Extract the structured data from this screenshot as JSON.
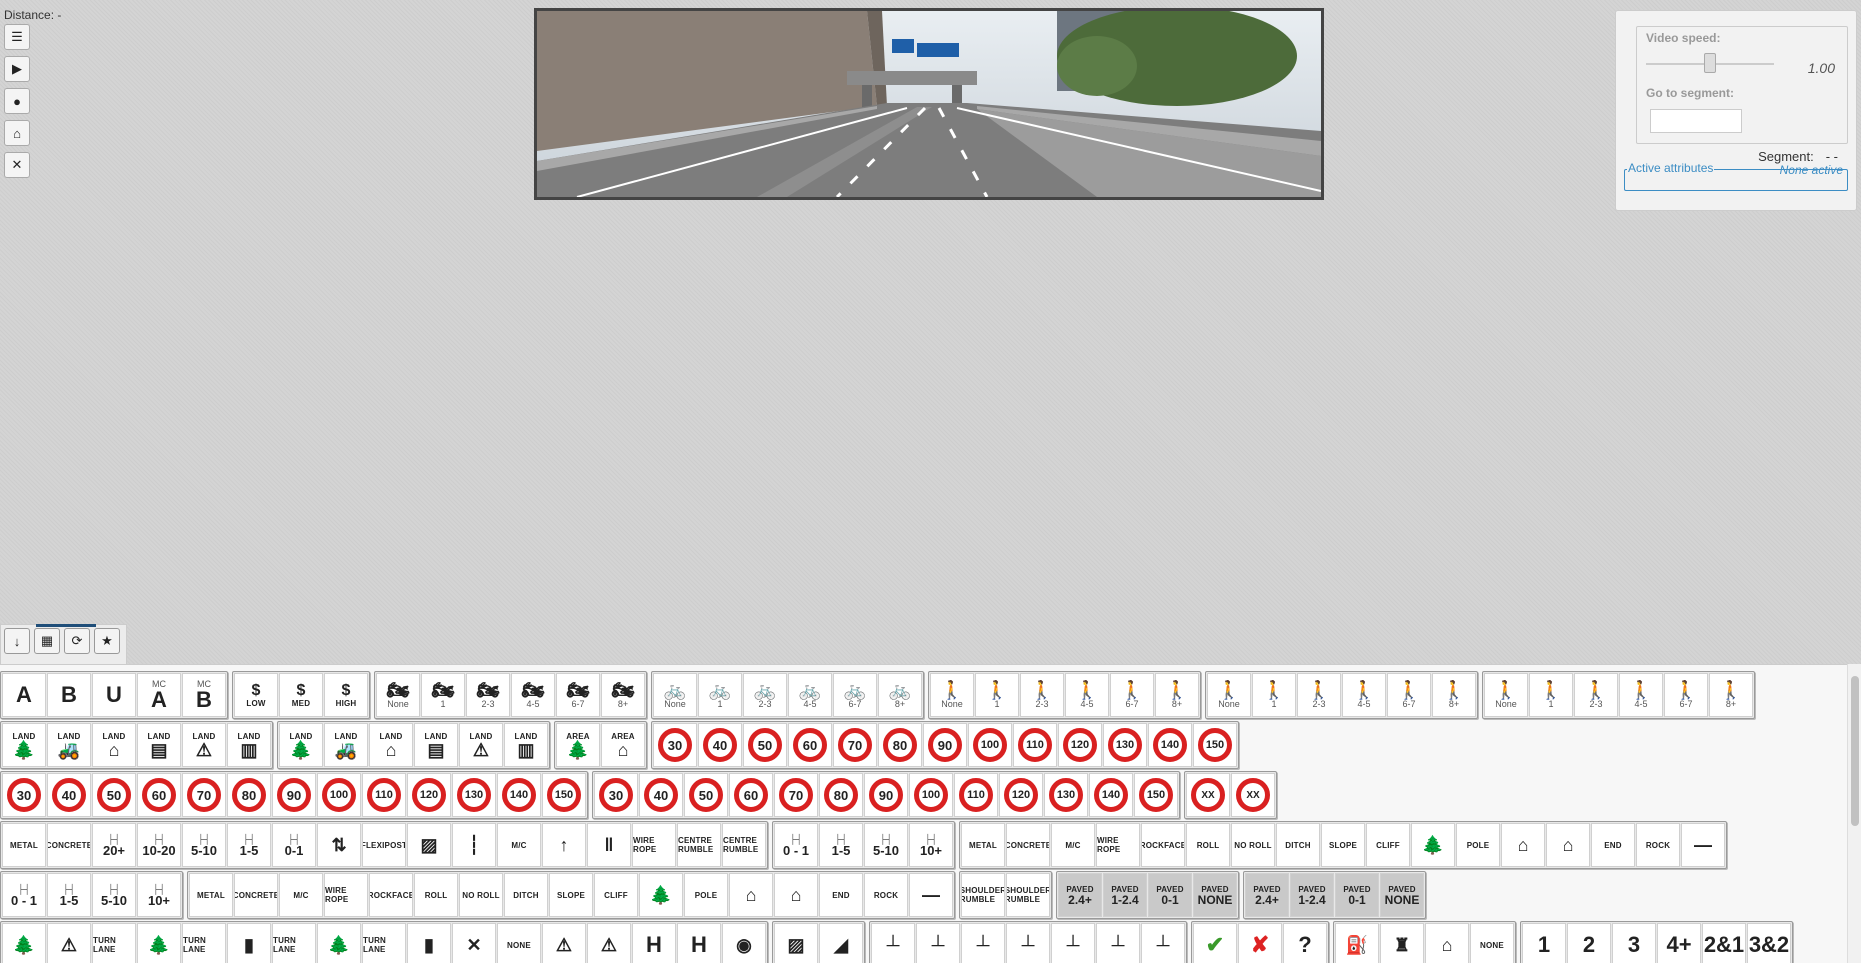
{
  "distance": "Distance: -",
  "panel": {
    "video_speed_label": "Video speed:",
    "video_speed_value": "1.00",
    "video_speed_level": 0.5,
    "goto_label": "Go to segment:",
    "segment_label": "Segment:",
    "segment_value": "- -",
    "active_title": "Active attributes",
    "active_value": "None active"
  },
  "side_tools": [
    "list-icon",
    "video-camera-icon",
    "map-pin-icon",
    "home-icon",
    "shuffle-icon"
  ],
  "tabs": [
    "arrow-down-icon",
    "grid-icon",
    "refresh-icon",
    "star-icon"
  ],
  "rows": [
    [
      [
        {
          "t": "big",
          "v": "A"
        },
        {
          "t": "big",
          "v": "B"
        },
        {
          "t": "big",
          "v": "U"
        },
        {
          "t": "bigsub",
          "v": "A",
          "s": "MC"
        },
        {
          "t": "bigsub",
          "v": "B",
          "s": "MC"
        }
      ],
      [
        {
          "t": "dollar",
          "v": "LOW"
        },
        {
          "t": "dollar",
          "v": "MED"
        },
        {
          "t": "dollar",
          "v": "HIGH"
        }
      ],
      [
        {
          "t": "icon",
          "i": "motorcycle-icon",
          "v": "None"
        },
        {
          "t": "icon",
          "i": "motorcycle-icon",
          "v": "1"
        },
        {
          "t": "icon",
          "i": "motorcycle-icon",
          "v": "2-3"
        },
        {
          "t": "icon",
          "i": "motorcycle-icon",
          "v": "4-5"
        },
        {
          "t": "icon",
          "i": "motorcycle-icon",
          "v": "6-7"
        },
        {
          "t": "icon",
          "i": "motorcycle-icon",
          "v": "8+"
        }
      ],
      [
        {
          "t": "icon",
          "i": "bicycle-icon",
          "v": "None"
        },
        {
          "t": "icon",
          "i": "bicycle-icon",
          "v": "1"
        },
        {
          "t": "icon",
          "i": "bicycle-icon",
          "v": "2-3"
        },
        {
          "t": "icon",
          "i": "bicycle-icon",
          "v": "4-5"
        },
        {
          "t": "icon",
          "i": "bicycle-icon",
          "v": "6-7"
        },
        {
          "t": "icon",
          "i": "bicycle-icon",
          "v": "8+"
        }
      ],
      [
        {
          "t": "icon",
          "i": "pedestrian-crossing-icon",
          "v": "None"
        },
        {
          "t": "icon",
          "i": "pedestrian-crossing-icon",
          "v": "1"
        },
        {
          "t": "icon",
          "i": "pedestrian-crossing-icon",
          "v": "2-3"
        },
        {
          "t": "icon",
          "i": "pedestrian-crossing-icon",
          "v": "4-5"
        },
        {
          "t": "icon",
          "i": "pedestrian-crossing-icon",
          "v": "6-7"
        },
        {
          "t": "icon",
          "i": "pedestrian-crossing-icon",
          "v": "8+"
        }
      ],
      [
        {
          "t": "icon",
          "i": "pedestrian-along-icon",
          "v": "None"
        },
        {
          "t": "icon",
          "i": "pedestrian-along-icon",
          "v": "1"
        },
        {
          "t": "icon",
          "i": "pedestrian-along-icon",
          "v": "2-3"
        },
        {
          "t": "icon",
          "i": "pedestrian-along-icon",
          "v": "4-5"
        },
        {
          "t": "icon",
          "i": "pedestrian-along-icon",
          "v": "6-7"
        },
        {
          "t": "icon",
          "i": "pedestrian-along-icon",
          "v": "8+"
        }
      ],
      [
        {
          "t": "icon",
          "i": "pedestrian-walking-icon",
          "v": "None"
        },
        {
          "t": "icon",
          "i": "pedestrian-walking-icon",
          "v": "1"
        },
        {
          "t": "icon",
          "i": "pedestrian-walking-icon",
          "v": "2-3"
        },
        {
          "t": "icon",
          "i": "pedestrian-walking-icon",
          "v": "4-5"
        },
        {
          "t": "icon",
          "i": "pedestrian-walking-icon",
          "v": "6-7"
        },
        {
          "t": "icon",
          "i": "pedestrian-walking-icon",
          "v": "8+"
        }
      ]
    ],
    [
      [
        {
          "t": "land",
          "i": "tree-icon",
          "s": "LAND"
        },
        {
          "t": "land",
          "i": "tractor-icon",
          "s": "LAND"
        },
        {
          "t": "land",
          "i": "house-icon",
          "s": "LAND"
        },
        {
          "t": "land",
          "i": "building-icon",
          "s": "LAND"
        },
        {
          "t": "land",
          "i": "school-warning-icon",
          "s": "LAND"
        },
        {
          "t": "land",
          "i": "factory-icon",
          "s": "LAND"
        }
      ],
      [
        {
          "t": "land",
          "i": "tree-icon",
          "s": "LAND"
        },
        {
          "t": "land",
          "i": "tractor-icon",
          "s": "LAND"
        },
        {
          "t": "land",
          "i": "house-icon",
          "s": "LAND"
        },
        {
          "t": "land",
          "i": "building-icon",
          "s": "LAND"
        },
        {
          "t": "land",
          "i": "school-warning-icon",
          "s": "LAND"
        },
        {
          "t": "land",
          "i": "factory-icon",
          "s": "LAND"
        }
      ],
      [
        {
          "t": "land",
          "i": "tree-icon",
          "s": "AREA"
        },
        {
          "t": "land",
          "i": "house-icon",
          "s": "AREA"
        }
      ],
      [
        {
          "t": "speed",
          "v": "30"
        },
        {
          "t": "speed",
          "v": "40"
        },
        {
          "t": "speed",
          "v": "50"
        },
        {
          "t": "speed",
          "v": "60"
        },
        {
          "t": "speed",
          "v": "70"
        },
        {
          "t": "speed",
          "v": "80"
        },
        {
          "t": "speed",
          "v": "90"
        },
        {
          "t": "speed",
          "v": "100"
        },
        {
          "t": "speed",
          "v": "110"
        },
        {
          "t": "speed",
          "v": "120"
        },
        {
          "t": "speed",
          "v": "130"
        },
        {
          "t": "speed",
          "v": "140"
        },
        {
          "t": "speed",
          "v": "150"
        }
      ]
    ],
    [
      [
        {
          "t": "speed",
          "v": "30"
        },
        {
          "t": "speed",
          "v": "40"
        },
        {
          "t": "speed",
          "v": "50"
        },
        {
          "t": "speed",
          "v": "60"
        },
        {
          "t": "speed",
          "v": "70"
        },
        {
          "t": "speed",
          "v": "80"
        },
        {
          "t": "speed",
          "v": "90"
        },
        {
          "t": "speed",
          "v": "100"
        },
        {
          "t": "speed",
          "v": "110"
        },
        {
          "t": "speed",
          "v": "120"
        },
        {
          "t": "speed",
          "v": "130"
        },
        {
          "t": "speed",
          "v": "140"
        },
        {
          "t": "speed",
          "v": "150"
        }
      ],
      [
        {
          "t": "speed",
          "v": "30"
        },
        {
          "t": "speed",
          "v": "40"
        },
        {
          "t": "speed",
          "v": "50"
        },
        {
          "t": "speed",
          "v": "60"
        },
        {
          "t": "speed",
          "v": "70"
        },
        {
          "t": "speed",
          "v": "80"
        },
        {
          "t": "speed",
          "v": "90"
        },
        {
          "t": "speed",
          "v": "100"
        },
        {
          "t": "speed",
          "v": "110"
        },
        {
          "t": "speed",
          "v": "120"
        },
        {
          "t": "speed",
          "v": "130"
        },
        {
          "t": "speed",
          "v": "140"
        },
        {
          "t": "speed",
          "v": "150"
        }
      ],
      [
        {
          "t": "speedx",
          "v": "XX"
        },
        {
          "t": "speedx",
          "v": "XX"
        }
      ]
    ],
    [
      [
        {
          "t": "small",
          "v": "METAL"
        },
        {
          "t": "small",
          "v": "CONCRETE"
        },
        {
          "t": "dist",
          "v": "20+"
        },
        {
          "t": "dist",
          "v": "10-20"
        },
        {
          "t": "dist",
          "v": "5-10"
        },
        {
          "t": "dist",
          "v": "1-5"
        },
        {
          "t": "dist",
          "v": "0-1"
        },
        {
          "t": "icon",
          "i": "barrier-icon",
          "v": ""
        },
        {
          "t": "small",
          "v": "FLEXIPOST"
        },
        {
          "t": "icon",
          "i": "hatched-icon",
          "v": ""
        },
        {
          "t": "icon",
          "i": "dashed-line-icon",
          "v": ""
        },
        {
          "t": "small",
          "v": "M/C"
        },
        {
          "t": "icon",
          "i": "arrow-up-icon",
          "v": ""
        },
        {
          "t": "icon",
          "i": "double-line-icon",
          "v": ""
        },
        {
          "t": "small",
          "v": "WIRE ROPE"
        },
        {
          "t": "small",
          "v": "CENTRE RUMBLE"
        },
        {
          "t": "small",
          "v": "CENTRE RUMBLE"
        }
      ],
      [
        {
          "t": "dist",
          "v": "0 - 1"
        },
        {
          "t": "dist",
          "v": "1-5"
        },
        {
          "t": "dist",
          "v": "5-10"
        },
        {
          "t": "dist",
          "v": "10+"
        }
      ],
      [
        {
          "t": "small",
          "v": "METAL"
        },
        {
          "t": "small",
          "v": "CONCRETE"
        },
        {
          "t": "small",
          "v": "M/C"
        },
        {
          "t": "small",
          "v": "WIRE ROPE"
        },
        {
          "t": "small",
          "v": "ROCKFACE"
        },
        {
          "t": "small",
          "v": "ROLL"
        },
        {
          "t": "small",
          "v": "NO ROLL"
        },
        {
          "t": "small",
          "v": "DITCH"
        },
        {
          "t": "small",
          "v": "SLOPE"
        },
        {
          "t": "small",
          "v": "CLIFF"
        },
        {
          "t": "icon",
          "i": "tree-icon",
          "v": ""
        },
        {
          "t": "small",
          "v": "POLE"
        },
        {
          "t": "icon",
          "i": "house-icon",
          "v": ""
        },
        {
          "t": "icon",
          "i": "house-outline-icon",
          "v": ""
        },
        {
          "t": "small",
          "v": "END"
        },
        {
          "t": "small",
          "v": "ROCK"
        },
        {
          "t": "icon",
          "i": "line-icon",
          "v": ""
        }
      ]
    ],
    [
      [
        {
          "t": "dist",
          "v": "0 - 1"
        },
        {
          "t": "dist",
          "v": "1-5"
        },
        {
          "t": "dist",
          "v": "5-10"
        },
        {
          "t": "dist",
          "v": "10+"
        }
      ],
      [
        {
          "t": "small",
          "v": "METAL"
        },
        {
          "t": "small",
          "v": "CONCRETE"
        },
        {
          "t": "small",
          "v": "M/C"
        },
        {
          "t": "small",
          "v": "WIRE ROPE"
        },
        {
          "t": "small",
          "v": "ROCKFACE"
        },
        {
          "t": "small",
          "v": "ROLL"
        },
        {
          "t": "small",
          "v": "NO ROLL"
        },
        {
          "t": "small",
          "v": "DITCH"
        },
        {
          "t": "small",
          "v": "SLOPE"
        },
        {
          "t": "small",
          "v": "CLIFF"
        },
        {
          "t": "icon",
          "i": "tree-icon",
          "v": ""
        },
        {
          "t": "small",
          "v": "POLE"
        },
        {
          "t": "icon",
          "i": "house-icon",
          "v": ""
        },
        {
          "t": "icon",
          "i": "house-outline-icon",
          "v": ""
        },
        {
          "t": "small",
          "v": "END"
        },
        {
          "t": "small",
          "v": "ROCK"
        },
        {
          "t": "icon",
          "i": "line-icon",
          "v": ""
        }
      ],
      [
        {
          "t": "small",
          "v": "SHOULDER RUMBLE"
        },
        {
          "t": "small",
          "v": "SHOULDER RUMBLE"
        }
      ],
      [
        {
          "t": "paved",
          "v": "2.4+"
        },
        {
          "t": "paved",
          "v": "1-2.4"
        },
        {
          "t": "paved",
          "v": "0-1"
        },
        {
          "t": "paved",
          "v": "NONE"
        }
      ],
      [
        {
          "t": "paved",
          "v": "2.4+"
        },
        {
          "t": "paved",
          "v": "1-2.4"
        },
        {
          "t": "paved",
          "v": "0-1"
        },
        {
          "t": "paved",
          "v": "NONE"
        }
      ]
    ],
    [
      [
        {
          "t": "icon",
          "i": "tree-icon",
          "v": ""
        },
        {
          "t": "icon",
          "i": "warning-icon",
          "v": ""
        },
        {
          "t": "small",
          "v": "TURN LANE"
        },
        {
          "t": "icon",
          "i": "tree-icon",
          "v": ""
        },
        {
          "t": "small",
          "v": "TURN LANE"
        },
        {
          "t": "icon",
          "i": "traffic-light-icon",
          "v": ""
        },
        {
          "t": "small",
          "v": "TURN LANE"
        },
        {
          "t": "icon",
          "i": "tree-icon",
          "v": ""
        },
        {
          "t": "small",
          "v": "TURN LANE"
        },
        {
          "t": "icon",
          "i": "traffic-light-icon",
          "v": ""
        },
        {
          "t": "icon",
          "i": "cross-icon",
          "v": ""
        },
        {
          "t": "small",
          "v": "NONE"
        },
        {
          "t": "icon",
          "i": "warning-icon",
          "v": ""
        },
        {
          "t": "icon",
          "i": "warning-icon",
          "v": ""
        },
        {
          "t": "big",
          "v": "H"
        },
        {
          "t": "big",
          "v": "H"
        },
        {
          "t": "icon",
          "i": "circle-icon",
          "v": ""
        }
      ],
      [
        {
          "t": "icon",
          "i": "hatched-icon",
          "v": ""
        },
        {
          "t": "icon",
          "i": "ramp-icon",
          "v": ""
        }
      ],
      [
        {
          "t": "icon",
          "i": "sign-icon",
          "v": ""
        },
        {
          "t": "icon",
          "i": "sign-icon",
          "v": ""
        },
        {
          "t": "icon",
          "i": "sign-icon",
          "v": ""
        },
        {
          "t": "icon",
          "i": "sign-icon",
          "v": ""
        },
        {
          "t": "icon",
          "i": "sign-icon",
          "v": ""
        },
        {
          "t": "icon",
          "i": "sign-icon",
          "v": ""
        },
        {
          "t": "icon",
          "i": "sign-icon",
          "v": ""
        }
      ],
      [
        {
          "t": "check",
          "v": "✔"
        },
        {
          "t": "crossmark",
          "v": "✘"
        },
        {
          "t": "big",
          "v": "?"
        }
      ],
      [
        {
          "t": "icon",
          "i": "fuel-icon",
          "v": ""
        },
        {
          "t": "icon",
          "i": "castle-icon",
          "v": ""
        },
        {
          "t": "icon",
          "i": "house-icon",
          "v": ""
        },
        {
          "t": "small",
          "v": "NONE"
        }
      ],
      [
        {
          "t": "big",
          "v": "1"
        },
        {
          "t": "big",
          "v": "2"
        },
        {
          "t": "big",
          "v": "3"
        },
        {
          "t": "big",
          "v": "4+"
        },
        {
          "t": "big",
          "v": "2&1"
        },
        {
          "t": "big",
          "v": "3&2"
        }
      ]
    ]
  ]
}
